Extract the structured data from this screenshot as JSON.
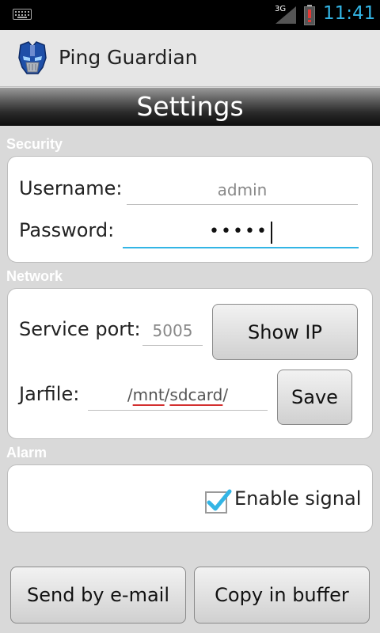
{
  "status_bar": {
    "time": "11:41",
    "network_label": "3G",
    "icons": [
      "keyboard-icon",
      "signal-icon",
      "battery-alert-icon"
    ],
    "clock_color": "#33b5e5"
  },
  "app": {
    "title": "Ping Guardian",
    "icon": "transformer-helmet-icon"
  },
  "header": {
    "title": "Settings"
  },
  "security": {
    "section_label": "Security",
    "username_label": "Username:",
    "username_value": "admin",
    "password_label": "Password:",
    "password_value": "•••••"
  },
  "network": {
    "section_label": "Network",
    "port_label": "Service port:",
    "port_value": "5005",
    "show_ip_label": "Show IP",
    "jarfile_label": "Jarfile:",
    "jarfile_parts": [
      "/",
      "mnt",
      "/",
      "sdcard",
      "/"
    ],
    "save_label": "Save"
  },
  "alarm": {
    "section_label": "Alarm",
    "enable_signal_label": "Enable signal",
    "enable_signal_checked": true
  },
  "footer": {
    "email_button": "Send by e-mail",
    "copy_button": "Copy in buffer"
  },
  "colors": {
    "accent": "#33b5e5",
    "spellcheck": "#d32f2f"
  }
}
